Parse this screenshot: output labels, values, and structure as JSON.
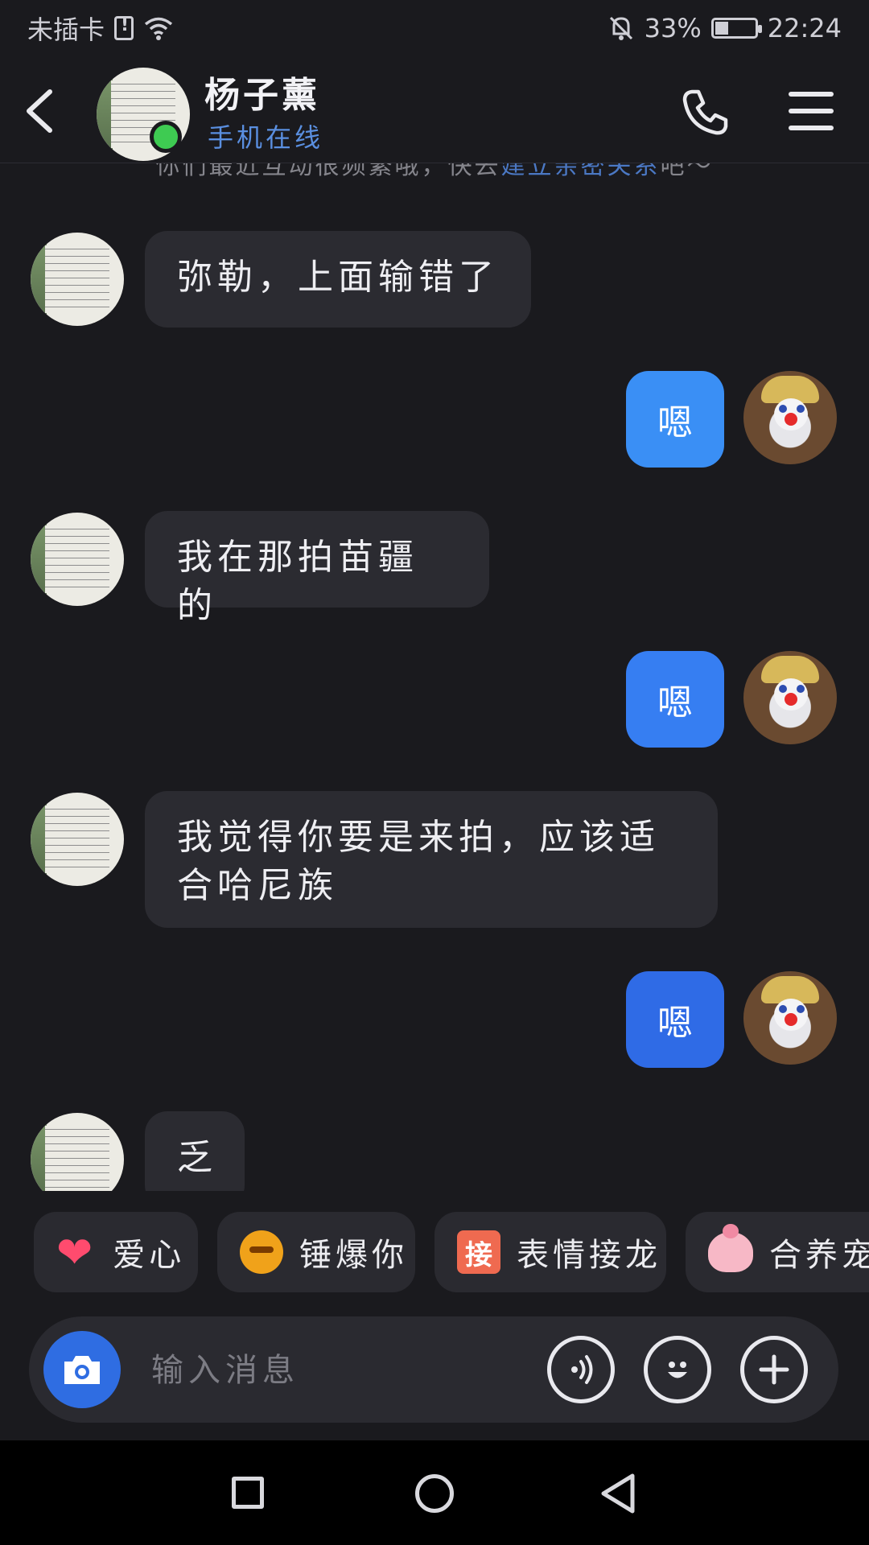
{
  "status_bar": {
    "carrier": "未插卡",
    "battery_percent": "33%",
    "time": "22:24",
    "icons": [
      "sim-alert-icon",
      "wifi-icon",
      "mute-bell-icon",
      "battery-charging-icon"
    ]
  },
  "header": {
    "contact_name": "杨子薰",
    "status": "手机在线",
    "icons": [
      "back-icon",
      "phone-call-icon",
      "menu-icon"
    ],
    "status_color": "#5a8fe0"
  },
  "chat": {
    "hint_text": "你们最近互动很频繁哦，快去",
    "hint_link": "建立亲密关系",
    "hint_suffix": "吧～",
    "messages": [
      {
        "side": "in",
        "text": "弥勒，上面输错了"
      },
      {
        "side": "out",
        "text": "嗯"
      },
      {
        "side": "in",
        "text": "我在那拍苗疆的"
      },
      {
        "side": "out",
        "text": "嗯"
      },
      {
        "side": "in",
        "text": "我觉得你要是来拍，应该适合哈尼族"
      },
      {
        "side": "out",
        "text": "嗯"
      },
      {
        "side": "in",
        "text": "乏"
      }
    ],
    "outgoing_bubble_colors": [
      "#3a8ff5",
      "#367ef2",
      "#2f6be6"
    ]
  },
  "quick_reactions": [
    {
      "label": "爱心",
      "icon": "heart-icon"
    },
    {
      "label": "锤爆你",
      "icon": "angry-emoji-icon"
    },
    {
      "label": "表情接龙",
      "icon": "jie-badge-icon",
      "badge": "接"
    },
    {
      "label": "合养宠物",
      "icon": "pet-icon"
    }
  ],
  "input_bar": {
    "placeholder": "输入消息",
    "icons": [
      "camera-icon",
      "voice-icon",
      "emoji-icon",
      "plus-icon"
    ]
  },
  "nav_bar": {
    "icons": [
      "recent-apps-icon",
      "home-icon",
      "back-triangle-icon"
    ]
  }
}
